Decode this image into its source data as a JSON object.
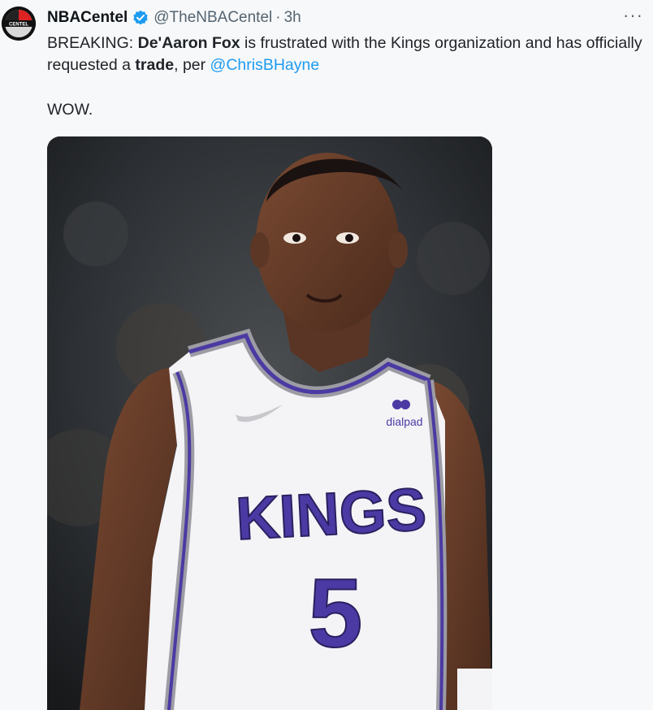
{
  "account": {
    "display_name": "NBACentel",
    "handle": "@TheNBACentel",
    "separator": "·",
    "time": "3h",
    "avatar_text": "CENTEL"
  },
  "tweet": {
    "prefix": "BREAKING: ",
    "bold_name": "De'Aaron Fox",
    "middle": " is frustrated with the Kings organization and has officially requested a ",
    "bold_word": "trade",
    "suffix": ", per ",
    "mention": "@ChrisBHayne",
    "second_line": "WOW."
  },
  "more_label": "···",
  "image": {
    "jersey_team": "KINGS",
    "jersey_number": "5",
    "sponsor": "dialpad"
  },
  "colors": {
    "verified": "#1d9bf0",
    "mention": "#1d9bf0",
    "jersey_purple": "#4b3aa3"
  }
}
